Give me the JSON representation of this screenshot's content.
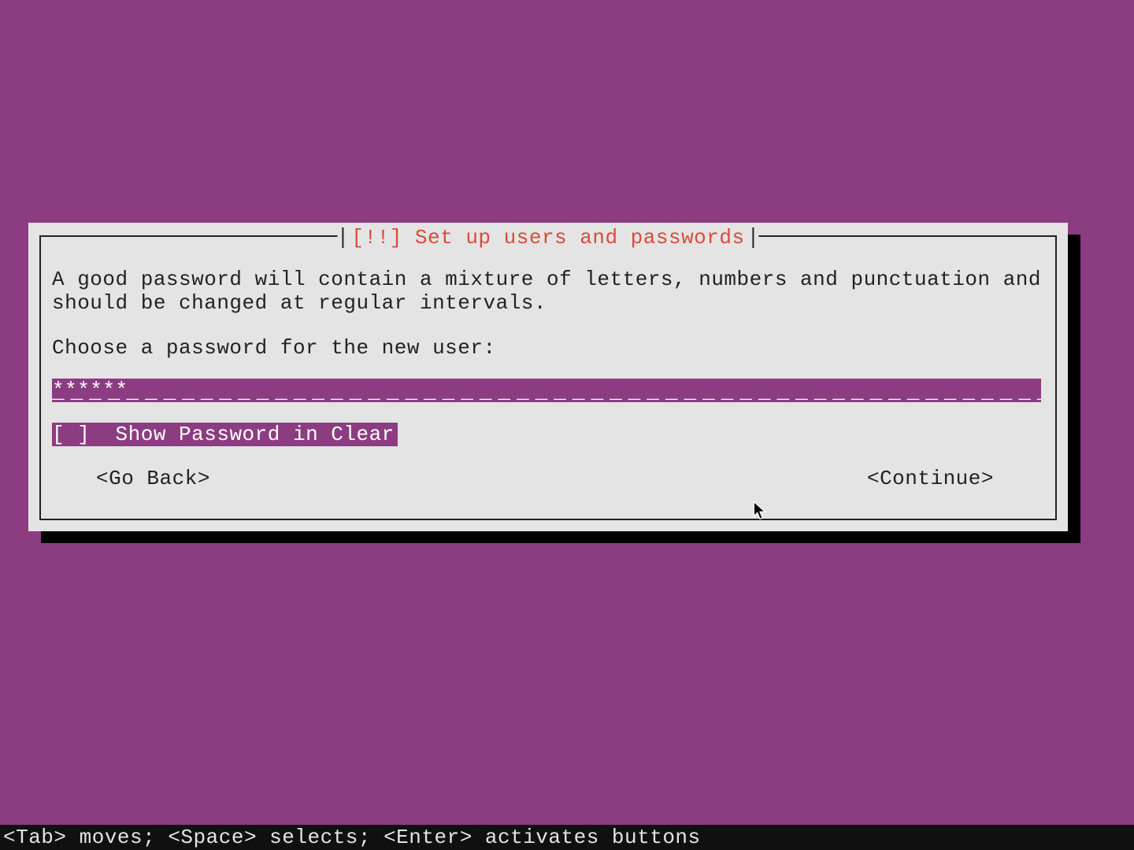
{
  "dialog": {
    "title": "[!!] Set up users and passwords",
    "description": "A good password will contain a mixture of letters, numbers and punctuation and should be changed at regular intervals.",
    "prompt": "Choose a password for the new user:",
    "password_value": "******",
    "checkbox": {
      "state": "[ ]",
      "label": "Show Password in Clear"
    },
    "buttons": {
      "go_back": "<Go Back>",
      "continue": "<Continue>"
    }
  },
  "footer": "<Tab> moves; <Space> selects; <Enter> activates buttons"
}
